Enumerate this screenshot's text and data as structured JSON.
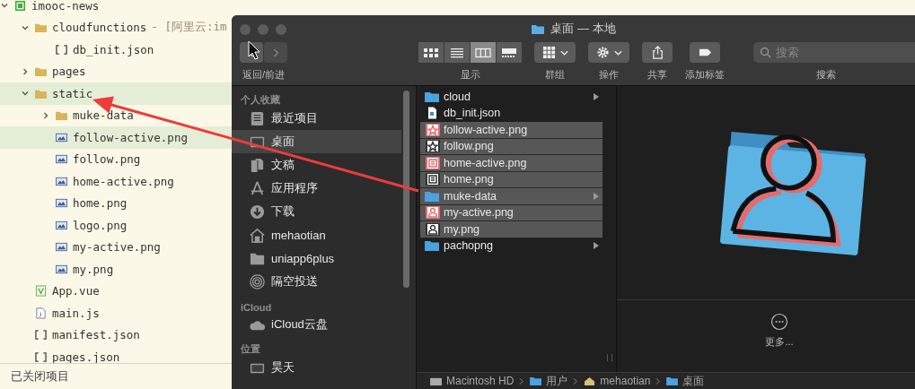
{
  "editor": {
    "tree": [
      {
        "label": "imooc-news",
        "kind": "project",
        "expanded": true,
        "selected": false,
        "children": [
          {
            "label": "cloudfunctions",
            "suffix": "- [阿里云:im",
            "kind": "cloud-folder",
            "expanded": true,
            "selected": false,
            "children": [
              {
                "label": "db_init.json",
                "kind": "json",
                "selected": false
              }
            ]
          },
          {
            "label": "pages",
            "kind": "folder",
            "expanded": false,
            "selected": false
          },
          {
            "label": "static",
            "kind": "folder",
            "expanded": true,
            "selected": true,
            "children": [
              {
                "label": "muke-data",
                "kind": "folder",
                "expanded": false,
                "selected": false
              },
              {
                "label": "follow-active.png",
                "kind": "image",
                "selected": true
              },
              {
                "label": "follow.png",
                "kind": "image",
                "selected": false
              },
              {
                "label": "home-active.png",
                "kind": "image",
                "selected": false
              },
              {
                "label": "home.png",
                "kind": "image",
                "selected": false
              },
              {
                "label": "logo.png",
                "kind": "image",
                "selected": false
              },
              {
                "label": "my-active.png",
                "kind": "image",
                "selected": false
              },
              {
                "label": "my.png",
                "kind": "image",
                "selected": false
              }
            ]
          },
          {
            "label": "App.vue",
            "kind": "vue",
            "selected": false
          },
          {
            "label": "main.js",
            "kind": "js",
            "selected": false
          },
          {
            "label": "manifest.json",
            "kind": "json",
            "selected": false
          },
          {
            "label": "pages.json",
            "kind": "json",
            "selected": false
          }
        ]
      }
    ],
    "closed_projects": "已关闭项目"
  },
  "finder": {
    "title": "桌面 — 本地",
    "nav": {
      "label": "返回/前进",
      "buttons": [
        {
          "kind": "back",
          "disabled": false
        },
        {
          "kind": "forward",
          "disabled": true
        }
      ]
    },
    "view": {
      "label": "显示",
      "options": [
        {
          "kind": "icons",
          "selected": false
        },
        {
          "kind": "list",
          "selected": false
        },
        {
          "kind": "columns",
          "selected": true
        },
        {
          "kind": "gallery",
          "selected": false
        }
      ]
    },
    "actions": [
      {
        "kind": "group",
        "label": "群组",
        "dropdown": true
      },
      {
        "kind": "action",
        "label": "操作",
        "dropdown": true
      },
      {
        "kind": "share",
        "label": "共享",
        "dropdown": false
      },
      {
        "kind": "tag",
        "label": "添加标签",
        "dropdown": false
      }
    ],
    "search": {
      "placeholder": "搜索",
      "label": "搜索"
    },
    "sidebar": [
      {
        "heading": "个人收藏",
        "items": [
          {
            "label": "最近项目",
            "kind": "recent",
            "selected": false
          },
          {
            "label": "桌面",
            "kind": "desktop",
            "selected": true
          },
          {
            "label": "文稿",
            "kind": "documents",
            "selected": false
          },
          {
            "label": "应用程序",
            "kind": "apps",
            "selected": false
          },
          {
            "label": "下载",
            "kind": "downloads",
            "selected": false
          },
          {
            "label": "mehaotian",
            "kind": "home",
            "selected": false
          },
          {
            "label": "uniapp6plus",
            "kind": "folder",
            "selected": false
          },
          {
            "label": "隔空投送",
            "kind": "airdrop",
            "selected": false
          }
        ]
      },
      {
        "heading": "iCloud",
        "items": [
          {
            "label": "iCloud云盘",
            "kind": "cloud",
            "selected": false
          }
        ]
      },
      {
        "heading": "位置",
        "items": [
          {
            "label": "昊天",
            "kind": "disk",
            "selected": false
          }
        ]
      }
    ],
    "files": [
      {
        "name": "cloud",
        "kind": "folder",
        "selected": false
      },
      {
        "name": "db_init.json",
        "kind": "json",
        "selected": false
      },
      {
        "name": "follow-active.png",
        "kind": "star-image",
        "color": "#e36b6b",
        "selected": true
      },
      {
        "name": "follow.png",
        "kind": "star-image",
        "color": "#333333",
        "selected": true
      },
      {
        "name": "home-active.png",
        "kind": "page-image",
        "color": "#e36b6b",
        "selected": true
      },
      {
        "name": "home.png",
        "kind": "page-image",
        "color": "#333333",
        "selected": true
      },
      {
        "name": "muke-data",
        "kind": "folder",
        "selected": true
      },
      {
        "name": "my-active.png",
        "kind": "person-image",
        "color": "#e36b6b",
        "selected": true
      },
      {
        "name": "my.png",
        "kind": "person-image",
        "color": "#333333",
        "selected": true
      },
      {
        "name": "pachopng",
        "kind": "folder",
        "selected": false
      }
    ],
    "more": "更多...",
    "path": [
      {
        "label": "Macintosh HD",
        "kind": "disk"
      },
      {
        "label": "用户",
        "kind": "folder"
      },
      {
        "label": "mehaotian",
        "kind": "home"
      },
      {
        "label": "桌面",
        "kind": "folder"
      }
    ]
  }
}
